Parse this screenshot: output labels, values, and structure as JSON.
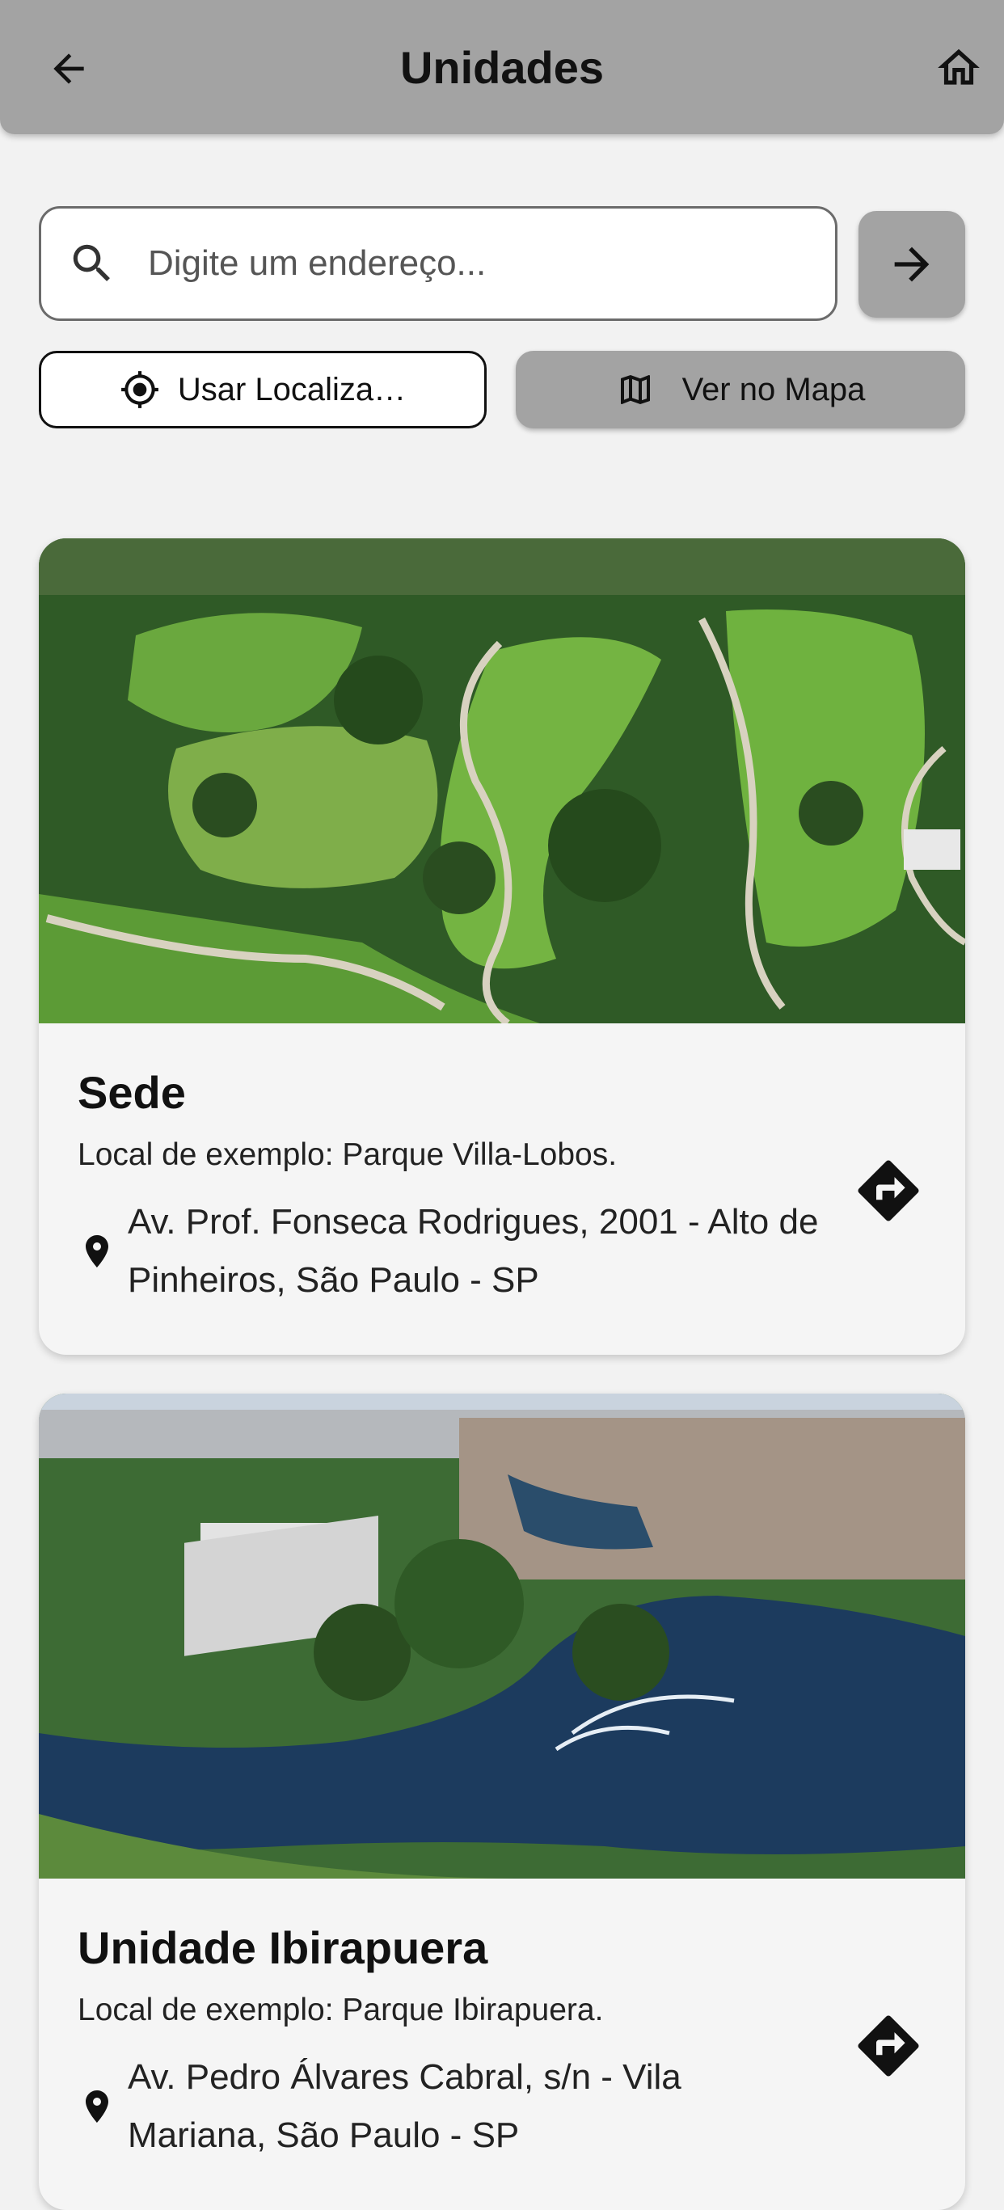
{
  "header": {
    "title": "Unidades"
  },
  "search": {
    "placeholder": "Digite um endereço..."
  },
  "actions": {
    "use_location": "Usar Localiza…",
    "view_map": "Ver no Mapa"
  },
  "units": [
    {
      "name": "Sede",
      "description": "Local de exemplo: Parque Villa-Lobos.",
      "address": "Av. Prof. Fonseca Rodrigues, 2001 - Alto de Pinheiros, São Paulo - SP"
    },
    {
      "name": "Unidade Ibirapuera",
      "description": "Local de exemplo: Parque Ibirapuera.",
      "address": "Av. Pedro Álvares Cabral, s/n - Vila Mariana, São Paulo - SP"
    }
  ],
  "colors": {
    "appbar": "#a3a3a3",
    "background": "#f2f2f2",
    "card": "#f5f5f5",
    "text": "#111111"
  },
  "icons": [
    "arrow-back-icon",
    "home-icon",
    "search-icon",
    "arrow-forward-icon",
    "my-location-icon",
    "map-icon",
    "location-pin-icon",
    "directions-icon"
  ]
}
